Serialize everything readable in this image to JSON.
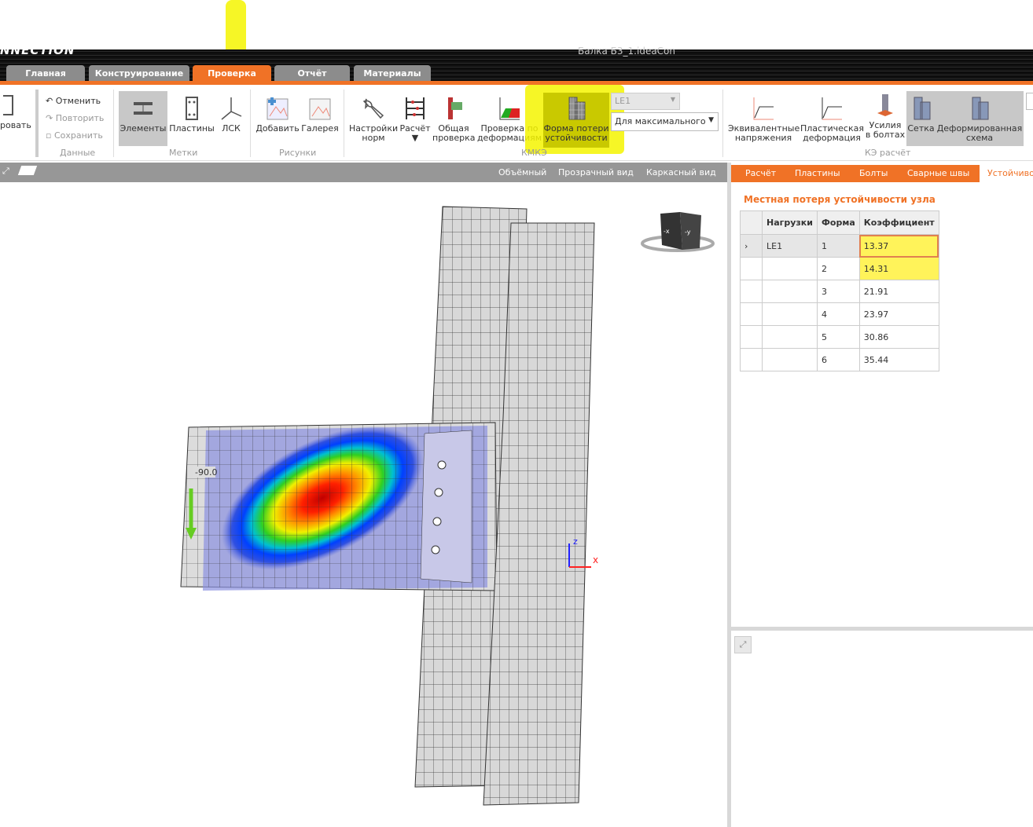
{
  "app": {
    "logo": "NNECTION",
    "document_title": "Балка Б3_1.ideaCon"
  },
  "tabs": [
    {
      "label": "Главная"
    },
    {
      "label": "Конструирование"
    },
    {
      "label": "Проверка",
      "active": true
    },
    {
      "label": "Отчёт"
    },
    {
      "label": "Материалы"
    }
  ],
  "ribbon": {
    "export_label": "ровать",
    "data": {
      "undo": "Отменить",
      "redo": "Повторить",
      "save": "Сохранить",
      "group": "Данные"
    },
    "labels": {
      "elements": "Элементы",
      "plates": "Пластины",
      "lcs": "ЛСК",
      "group": "Метки"
    },
    "pictures": {
      "add": "Добавить",
      "gallery": "Галерея",
      "group": "Рисунки"
    },
    "check": {
      "code_settings_1": "Настройки",
      "code_settings_2": "норм",
      "calc": "Расчёт",
      "calc_arrow": "▼",
      "overall_1": "Общая",
      "overall_2": "проверка",
      "deform_1": "Проверка по",
      "deform_2": "деформациям",
      "buckling_1": "Форма потери",
      "buckling_2": "устойчивости",
      "load_select": "LE1",
      "mode_select": "Для максимального",
      "group": "КМКЭ"
    },
    "fea": {
      "equiv_1": "Эквивалентные",
      "equiv_2": "напряжения",
      "plastic_1": "Пластическая",
      "plastic_2": "деформация",
      "bolts_1": "Усилия",
      "bolts_2": "в болтах",
      "mesh": "Сетка",
      "deformed_1": "Деформированная",
      "deformed_2": "схема",
      "group": "КЭ расчёт"
    }
  },
  "viewbar": {
    "solid": "Объёмный",
    "transparent": "Прозрачный вид",
    "wireframe": "Каркасный вид"
  },
  "viewport": {
    "load_value": "-90.0",
    "axis_z": "z",
    "axis_x": "x",
    "cube_left": "-x",
    "cube_right": "-y"
  },
  "right_tabs": [
    {
      "label": "Расчёт"
    },
    {
      "label": "Пластины"
    },
    {
      "label": "Болты"
    },
    {
      "label": "Сварные швы"
    },
    {
      "label": "Устойчивос",
      "active": true
    }
  ],
  "panel": {
    "title": "Местная потеря устойчивости узла",
    "headers": [
      "Нагрузки",
      "Форма",
      "Коэффициент"
    ],
    "rows": [
      {
        "load": "LE1",
        "shape": "1",
        "factor": "13.37"
      },
      {
        "load": "",
        "shape": "2",
        "factor": "14.31"
      },
      {
        "load": "",
        "shape": "3",
        "factor": "21.91"
      },
      {
        "load": "",
        "shape": "4",
        "factor": "23.97"
      },
      {
        "load": "",
        "shape": "5",
        "factor": "30.86"
      },
      {
        "load": "",
        "shape": "6",
        "factor": "35.44"
      }
    ]
  },
  "colors": {
    "accent": "#f07226",
    "highlight": "#f5f500"
  }
}
